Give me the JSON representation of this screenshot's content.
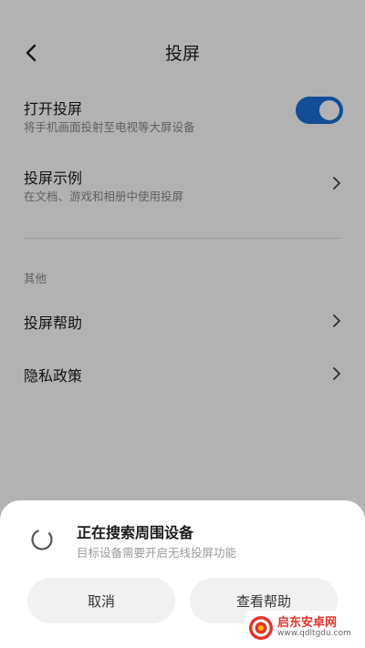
{
  "header": {
    "title": "投屏"
  },
  "settings": {
    "open_cast": {
      "title": "打开投屏",
      "subtitle": "将手机画面投射至电视等大屏设备",
      "enabled": true
    },
    "cast_example": {
      "title": "投屏示例",
      "subtitle": "在文档、游戏和相册中使用投屏"
    },
    "section_other": "其他",
    "cast_help": "投屏帮助",
    "privacy_policy": "隐私政策"
  },
  "sheet": {
    "title": "正在搜索周围设备",
    "subtitle": "目标设备需要开启无线投屏功能",
    "cancel_label": "取消",
    "help_label": "查看帮助"
  },
  "watermark": {
    "name": "启东安卓网",
    "url": "www.qdltgdu.com"
  },
  "colors": {
    "toggle_on": "#1a6fd6",
    "sheet_bg": "#ffffff",
    "overlay": "rgba(0,0,0,0.30)"
  }
}
